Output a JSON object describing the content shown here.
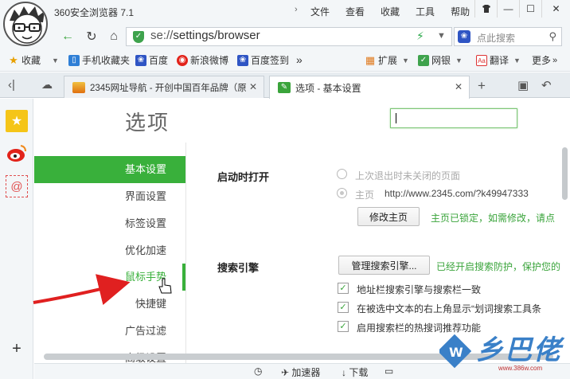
{
  "titlebar": {
    "app_title": "360安全浏览器 7.1",
    "menus": [
      "文件",
      "查看",
      "收藏",
      "工具",
      "帮助"
    ]
  },
  "addressbar": {
    "url_prefix": "se://",
    "url_path": "settings/browser",
    "search_placeholder": "点此搜索"
  },
  "bookmarks": {
    "favorites": "收藏",
    "items": [
      "手机收藏夹",
      "百度",
      "新浪微博",
      "百度签到"
    ],
    "more_arrow": "»",
    "extensions": "扩展",
    "netbank": "网银",
    "translate": "翻译",
    "more": "更多"
  },
  "tabs": [
    {
      "title": "2345网址导航 - 开创中国百年品牌（原",
      "active": false
    },
    {
      "title": "选项 - 基本设置",
      "active": true
    }
  ],
  "settings": {
    "page_title": "选项",
    "nav": [
      {
        "label": "基本设置",
        "state": "active"
      },
      {
        "label": "界面设置",
        "state": "normal"
      },
      {
        "label": "标签设置",
        "state": "normal"
      },
      {
        "label": "优化加速",
        "state": "normal"
      },
      {
        "label": "鼠标手势",
        "state": "hover"
      },
      {
        "label": "快捷键",
        "state": "normal"
      },
      {
        "label": "广告过滤",
        "state": "normal"
      },
      {
        "label": "高级设置",
        "state": "normal"
      }
    ],
    "startup": {
      "label": "启动时打开",
      "option_last": "上次退出时未关闭的页面",
      "option_home": "主页",
      "home_url": "http://www.2345.com/?k49947333",
      "modify_button": "修改主页",
      "locked_note": "主页已锁定，如需修改，请点"
    },
    "search": {
      "label": "搜索引擎",
      "manage_button": "管理搜索引擎...",
      "protect_note": "已经开启搜索防护，保护您的",
      "checks": [
        {
          "label": "地址栏搜索引擎与搜索栏一致",
          "checked": true
        },
        {
          "label": "在被选中文本的右上角显示“划词搜索工具条",
          "checked": true
        },
        {
          "label": "启用搜索栏的热搜词推荐功能",
          "checked": true
        }
      ]
    }
  },
  "statusbar": {
    "accelerator": "加速器",
    "download": "下载"
  },
  "watermark": {
    "text": "乡巴佬",
    "url": "www.386w.com"
  },
  "colors": {
    "accent_green": "#39b03b",
    "arrow_red": "#e02020"
  }
}
